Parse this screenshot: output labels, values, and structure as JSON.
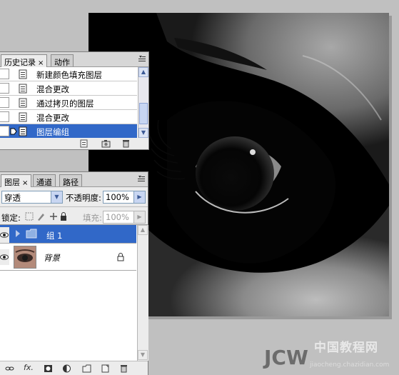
{
  "history_panel": {
    "tabs": [
      {
        "label": "历史记录",
        "close": "×"
      },
      {
        "label": "动作"
      }
    ],
    "menu_icon": "panel-menu-icon",
    "items": [
      {
        "label": "新建颜色填充图层",
        "selected": false
      },
      {
        "label": "混合更改",
        "selected": false
      },
      {
        "label": "通过拷贝的图层",
        "selected": false
      },
      {
        "label": "混合更改",
        "selected": false
      },
      {
        "label": "图层编组",
        "selected": true
      }
    ],
    "footer_icons": [
      "new-document-from-state-icon",
      "camera-snapshot-icon",
      "trash-icon"
    ]
  },
  "layers_panel": {
    "tabs": [
      {
        "label": "图层",
        "close": "×"
      },
      {
        "label": "通道"
      },
      {
        "label": "路径"
      }
    ],
    "blend_mode": "穿透",
    "opacity_label": "不透明度:",
    "opacity_value": "100%",
    "lock_label": "锁定:",
    "fill_label": "填充:",
    "fill_value": "100%",
    "layers": [
      {
        "name": "组 1",
        "type": "group",
        "selected": true
      },
      {
        "name": "背景",
        "type": "background",
        "selected": false,
        "locked": true
      }
    ],
    "footer_icons": [
      "link-icon",
      "fx-icon",
      "mask-icon",
      "adjustment-icon",
      "folder-icon",
      "new-layer-icon",
      "trash-icon"
    ],
    "fx_text": "fx."
  },
  "watermark": {
    "line1": "中国教程网",
    "line2": "JCW",
    "line3": "jiaocheng.chazidian.com"
  },
  "colors": {
    "selection": "#3168c8",
    "panel_bg": "#ececec",
    "workspace": "#c0c0c0"
  }
}
